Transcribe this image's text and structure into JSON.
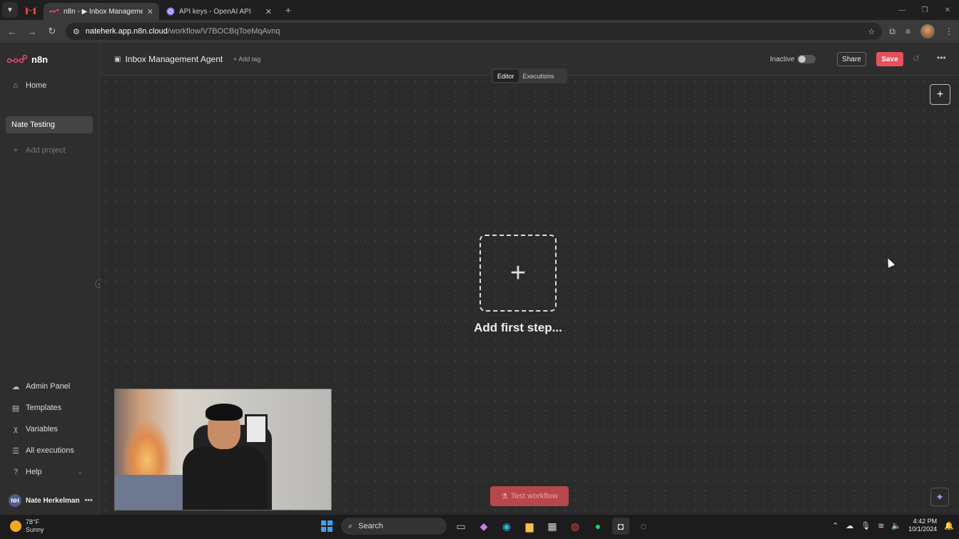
{
  "browser": {
    "tabs": [
      {
        "title": "n8n - ▶ Inbox Management",
        "active": true
      },
      {
        "title": "API keys - OpenAI API",
        "active": false
      }
    ],
    "url_host": "nateherk.app.n8n.cloud",
    "url_path": "/workflow/V7BOCBqToeMqAvnq"
  },
  "sidebar": {
    "logo_text": "n8n",
    "home": "Home",
    "project": "Nate Testing",
    "add_project": "Add project",
    "admin_panel": "Admin Panel",
    "templates": "Templates",
    "variables": "Variables",
    "all_executions": "All executions",
    "help": "Help",
    "user_initials": "NH",
    "user_name": "Nate Herkelman"
  },
  "header": {
    "workflow_title": "Inbox Management Agent",
    "add_tag": "+ Add tag",
    "status": "Inactive",
    "share": "Share",
    "save": "Save"
  },
  "mode": {
    "editor": "Editor",
    "executions": "Executions"
  },
  "canvas": {
    "add_first_step": "Add first step...",
    "test_workflow": "Test workflow"
  },
  "taskbar": {
    "temperature": "78°F",
    "condition": "Sunny",
    "search": "Search",
    "time": "4:42 PM",
    "date": "10/1/2024"
  },
  "colors": {
    "save_accent": "#e8505b",
    "n8n_brand": "#ea4b71"
  }
}
